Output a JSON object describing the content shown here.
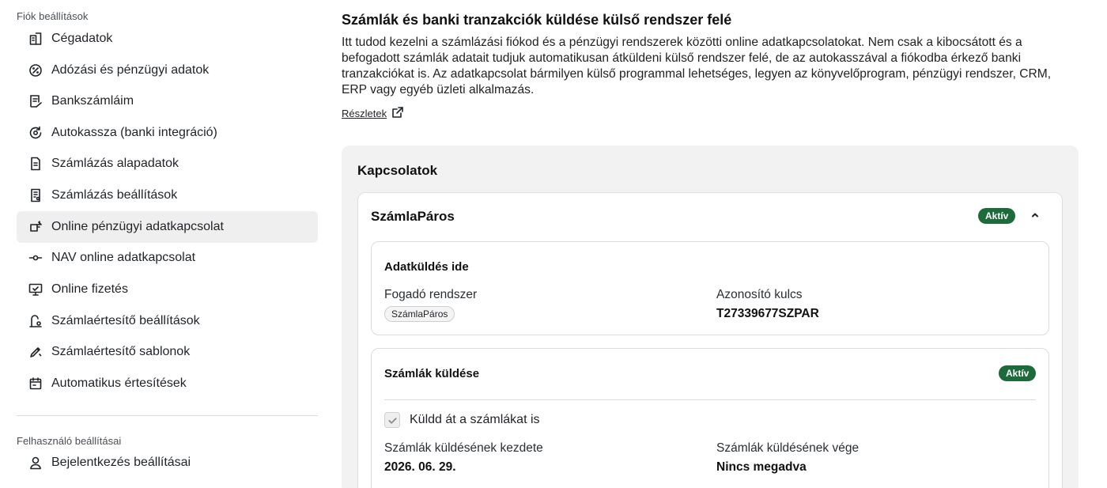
{
  "sidebar": {
    "account_section_label": "Fiók beállítások",
    "items": [
      {
        "label": "Cégadatok",
        "icon": "building-icon"
      },
      {
        "label": "Adózási és pénzügyi adatok",
        "icon": "percent-icon"
      },
      {
        "label": "Bankszámláim",
        "icon": "bank-note-icon"
      },
      {
        "label": "Autokassza (banki integráció)",
        "icon": "sync-icon"
      },
      {
        "label": "Számlázás alapadatok",
        "icon": "document-icon"
      },
      {
        "label": "Számlázás beállítások",
        "icon": "document-settings-icon"
      },
      {
        "label": "Online pénzügyi adatkapcsolat",
        "icon": "plug-icon"
      },
      {
        "label": "NAV online adatkapcsolat",
        "icon": "commit-icon"
      },
      {
        "label": "Online fizetés",
        "icon": "monitor-icon"
      },
      {
        "label": "Számlaértesítő beállítások",
        "icon": "notice-settings-icon"
      },
      {
        "label": "Számlaértesítő sablonok",
        "icon": "template-icon"
      },
      {
        "label": "Automatikus értesítések",
        "icon": "calendar-icon"
      }
    ],
    "active_index": 6,
    "user_section_label": "Felhasználó beállításai",
    "user_items": [
      {
        "label": "Bejelentkezés beállításai",
        "icon": "user-icon"
      }
    ]
  },
  "main": {
    "title": "Számlák és banki tranzakciók küldése külső rendszer felé",
    "description": "Itt tudod kezelni a számlázási fiókod és a pénzügyi rendszerek közötti online adatkapcsolatokat. Nem csak a kibocsátott és a befogadott számlák adatait tudjuk automatikusan átküldeni külső rendszer felé, de az autokasszával a fiókodba érkező banki tranzakciókat is. Az adatkapcsolat bármilyen külső programmal lehetséges, legyen az könyvelőprogram, pénzügyi rendszer, CRM, ERP vagy egyéb üzleti alkalmazás.",
    "details_link": "Részletek"
  },
  "connections": {
    "title": "Kapcsolatok",
    "card": {
      "name": "SzámlaPáros",
      "status": "Aktív",
      "target": {
        "title": "Adatküldés ide",
        "receiver_label": "Fogadó rendszer",
        "receiver_value": "SzámlaPáros",
        "key_label": "Azonosító kulcs",
        "key_value": "T27339677SZPAR"
      },
      "invoices": {
        "title": "Számlák küldése",
        "status": "Aktív",
        "checkbox_label": "Küldd át a számlákat is",
        "checkbox_checked": true,
        "start_label": "Számlák küldésének kezdete",
        "start_value": "2026. 06. 29.",
        "end_label": "Számlák küldésének vége",
        "end_value": "Nincs megadva"
      }
    }
  }
}
